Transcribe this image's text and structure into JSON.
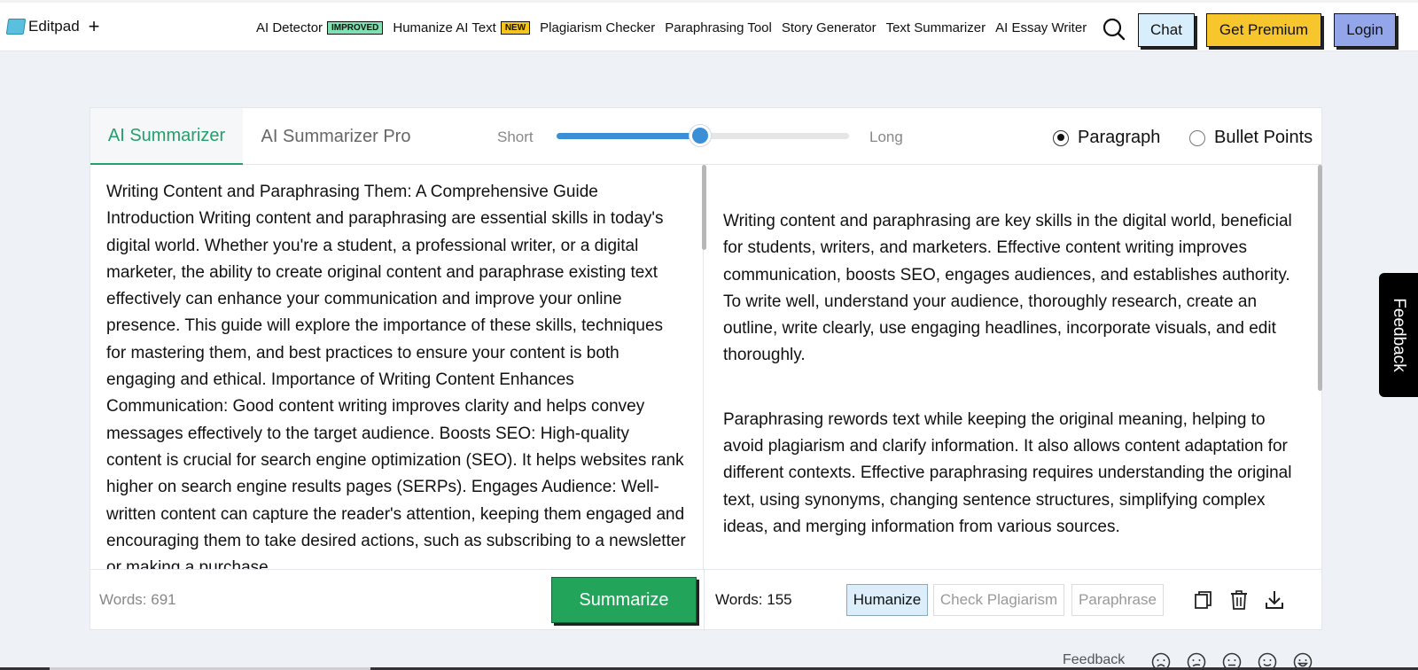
{
  "app": {
    "logo_text": "Editpad",
    "logo_plus": "+"
  },
  "nav": {
    "items": [
      {
        "label": "AI Detector",
        "badge": "IMPROVED",
        "badge_color": "#7fe0b2"
      },
      {
        "label": "Humanize AI Text",
        "badge": "NEW",
        "badge_color": "#f5c518"
      },
      {
        "label": "Plagiarism Checker"
      },
      {
        "label": "Paraphrasing Tool"
      },
      {
        "label": "Story Generator"
      },
      {
        "label": "Text Summarizer"
      },
      {
        "label": "AI Essay Writer"
      }
    ],
    "search_icon": "search-icon",
    "chat_label": "Chat",
    "premium_label": "Get Premium",
    "login_label": "Login"
  },
  "summarizer": {
    "tabs": [
      {
        "label": "AI Summarizer",
        "active": true
      },
      {
        "label": "AI Summarizer Pro",
        "active": false
      }
    ],
    "length": {
      "short_label": "Short",
      "long_label": "Long",
      "value_fraction": 0.49
    },
    "modes": [
      {
        "label": "Paragraph",
        "selected": true
      },
      {
        "label": "Bullet Points",
        "selected": false
      }
    ],
    "input_text": "Writing Content and Paraphrasing Them: A Comprehensive Guide Introduction Writing content and paraphrasing are essential skills in today's digital world. Whether you're a student, a professional writer, or a digital marketer, the ability to create original content and paraphrase existing text effectively can enhance your communication and improve your online presence. This guide will explore the importance of these skills, techniques for mastering them, and best practices to ensure your content is both engaging and ethical. Importance of Writing Content Enhances Communication: Good content writing improves clarity and helps convey messages effectively to the target audience. Boosts SEO: High-quality content is crucial for search engine optimization (SEO). It helps websites rank higher on search engine results pages (SERPs). Engages Audience: Well-written content can capture the reader's attention, keeping them engaged and encouraging them to take desired actions, such as subscribing to a newsletter or making a purchase.",
    "output_paragraphs": [
      "Writing content and paraphrasing are key skills in the digital world, beneficial for students, writers, and marketers. Effective content writing improves communication, boosts SEO, engages audiences, and establishes authority. To write well, understand your audience, thoroughly research, create an outline, write clearly, use engaging headlines, incorporate visuals, and edit thoroughly.",
      "Paraphrasing rewords text while keeping the original meaning, helping to avoid plagiarism and clarify information. It also allows content adaptation for different contexts. Effective paraphrasing requires understanding the original text, using synonyms, changing sentence structures, simplifying complex ideas, and merging information from various sources."
    ],
    "input_words": "Words: 691",
    "summarize_label": "Summarize",
    "output_words": "Words: 155",
    "actions": [
      {
        "label": "Humanize"
      },
      {
        "label": "Check Plagiarism"
      },
      {
        "label": "Paraphrase"
      }
    ],
    "tool_icons": [
      "copy-icon",
      "delete-icon",
      "download-icon"
    ]
  },
  "feedback": {
    "side_label": "Feedback",
    "bottom_label": "Feedback",
    "faces": [
      "very-sad-face-icon",
      "sad-face-icon",
      "neutral-face-icon",
      "happy-face-icon",
      "very-happy-face-icon"
    ]
  },
  "colors": {
    "accent_green": "#22a06b",
    "summarize_green": "#22a55b",
    "slider_blue": "#3b8fd6",
    "premium_yellow": "#f7c52c",
    "login_blue": "#93a6ea",
    "chat_blue": "#d9eefc"
  }
}
